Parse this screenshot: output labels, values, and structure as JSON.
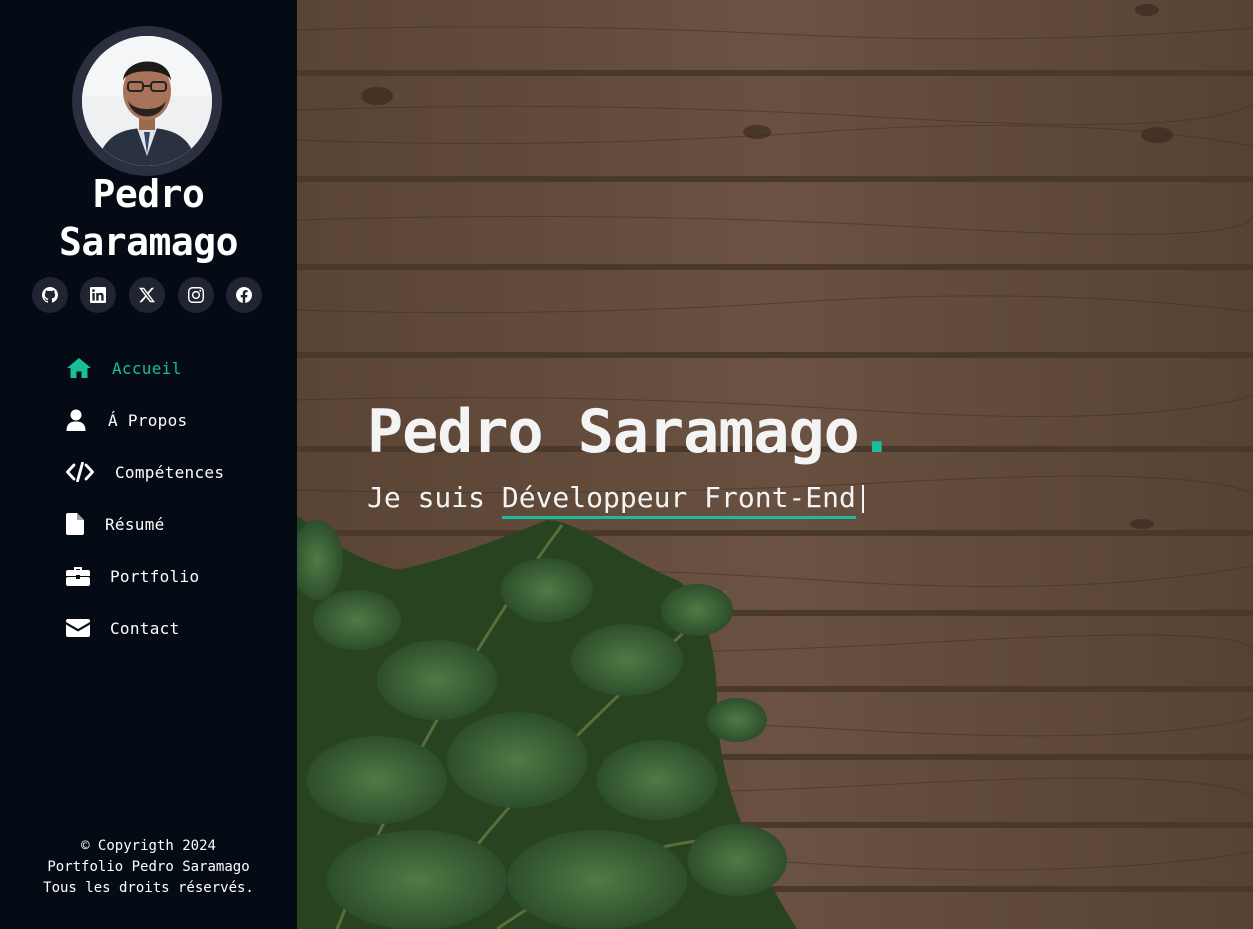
{
  "profile": {
    "name": "Pedro Saramago"
  },
  "socials": [
    {
      "icon": "github-icon"
    },
    {
      "icon": "linkedin-icon"
    },
    {
      "icon": "x-twitter-icon"
    },
    {
      "icon": "instagram-icon"
    },
    {
      "icon": "facebook-icon"
    }
  ],
  "nav": {
    "items": [
      {
        "label": "Accueil",
        "icon": "home-icon",
        "active": true
      },
      {
        "label": "Á Propos",
        "icon": "user-icon"
      },
      {
        "label": "Compétences",
        "icon": "code-icon"
      },
      {
        "label": "Résumé",
        "icon": "file-icon"
      },
      {
        "label": "Portfolio",
        "icon": "briefcase-icon"
      },
      {
        "label": "Contact",
        "icon": "envelope-icon"
      }
    ]
  },
  "footer": {
    "line1": "© Copyrigth 2024",
    "line2": "Portfolio Pedro Saramago",
    "line3": "Tous les droits réservés."
  },
  "hero": {
    "title": "Pedro Saramago",
    "title_dot": ".",
    "subtitle_prefix": "Je suis ",
    "typed_text": "Développeur Front-End"
  },
  "colors": {
    "accent": "#1abc9c",
    "sidebar_bg": "#040b14",
    "social_bg": "#212431"
  }
}
